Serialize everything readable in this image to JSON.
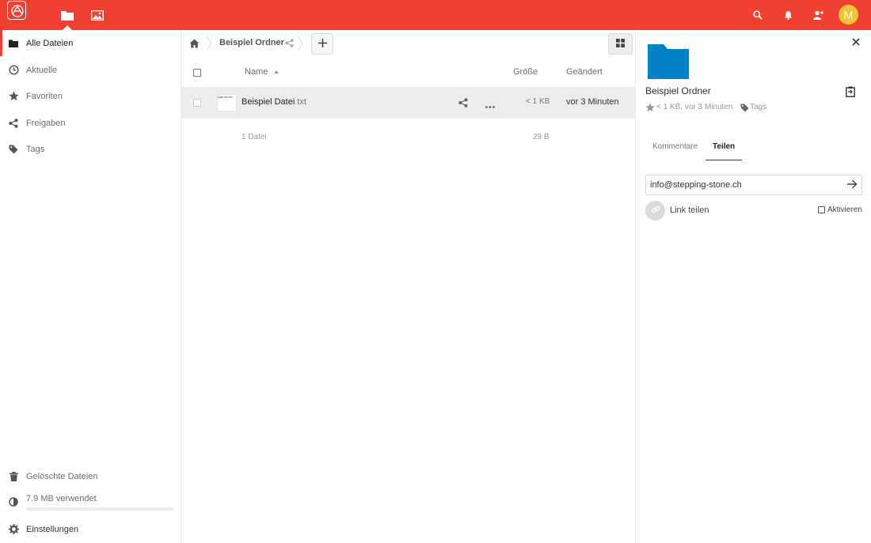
{
  "header": {
    "apps": [
      {
        "name": "files",
        "icon": "folder-icon",
        "active": true
      },
      {
        "name": "gallery",
        "icon": "image-icon",
        "active": false
      }
    ],
    "avatar_initial": "M",
    "colors": {
      "brand": "#f13f31",
      "avatar": "#f1c339"
    }
  },
  "sidebar": {
    "items": [
      {
        "label": "Alle Dateien",
        "icon": "folder-icon",
        "active": true
      },
      {
        "label": "Aktuelle",
        "icon": "clock-icon"
      },
      {
        "label": "Favoriten",
        "icon": "star-icon"
      },
      {
        "label": "Freigaben",
        "icon": "share-icon"
      },
      {
        "label": "Tags",
        "icon": "tag-icon"
      }
    ],
    "deleted_files": "Gelöschte Dateien",
    "quota": "7.9 MB verwendet",
    "settings": "Einstellungen"
  },
  "breadcrumb": {
    "folder": "Beispiel Ordner"
  },
  "table": {
    "headers": {
      "name": "Name",
      "size": "Größe",
      "modified": "Geändert"
    },
    "rows": [
      {
        "thumb_text": "Das ist ein",
        "basename": "Beispiel Datei",
        "ext": ".txt",
        "size": "< 1 KB",
        "modified": "vor 3 Minuten"
      }
    ],
    "summary": {
      "files": "1 Datei",
      "size": "29 B"
    }
  },
  "details": {
    "title": "Beispiel Ordner",
    "meta": "< 1 KB, vor 3 Minuten",
    "tags": "Tags",
    "tabs": [
      "Kommentare",
      "Teilen"
    ],
    "active_tab": "Teilen",
    "share_input_value": "info@stepping-stone.ch",
    "link_label": "Link teilen",
    "activate_label": "Aktivieren",
    "folder_color": "#0082c9"
  }
}
